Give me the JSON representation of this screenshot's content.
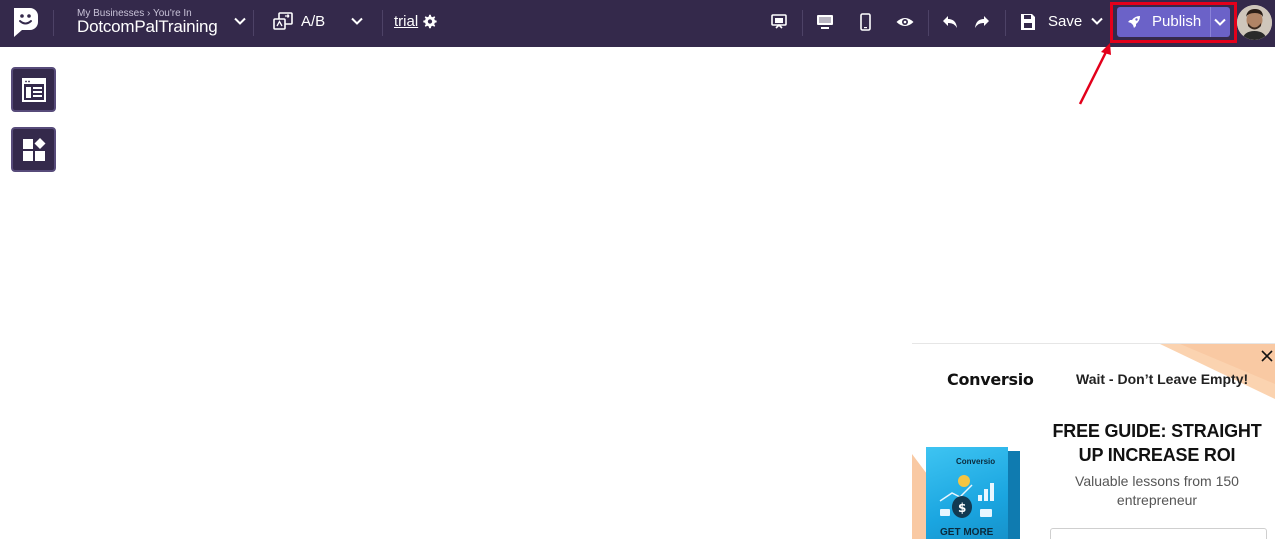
{
  "topbar": {
    "business_crumb": "My Businesses › You're In",
    "business_name": "DotcomPalTraining",
    "ab_label": "A/B",
    "page_name": "trial",
    "save_label": "Save",
    "publish_label": "Publish"
  },
  "popup": {
    "brand": "Conversio",
    "wait_text": "Wait - Don’t Leave Empty!",
    "headline": "FREE GUIDE: STRAIGHT UP INCREASE ROI",
    "subtext": "Valuable lessons from 150 entrepreneur",
    "book_brand": "Conversio",
    "book_cta": "GET MORE"
  },
  "colors": {
    "topbar_bg": "#34294b",
    "publish_bg": "#6b62c8",
    "highlight": "#e3001b",
    "popup_accent": "#f9c9a3",
    "book_blue": "#1aa5e0"
  },
  "icons": {
    "logo": "chat-smile-logo-icon",
    "ab": "ab-test-icon",
    "settings": "gear-icon",
    "tool_1": "layout-section-icon",
    "tool_2": "blocks-widgets-icon",
    "toolbar": [
      "screen-share-icon",
      "desktop-icon",
      "mobile-icon",
      "eye-icon",
      "undo-icon",
      "redo-icon",
      "save-floppy-icon"
    ],
    "publish": "rocket-icon"
  }
}
